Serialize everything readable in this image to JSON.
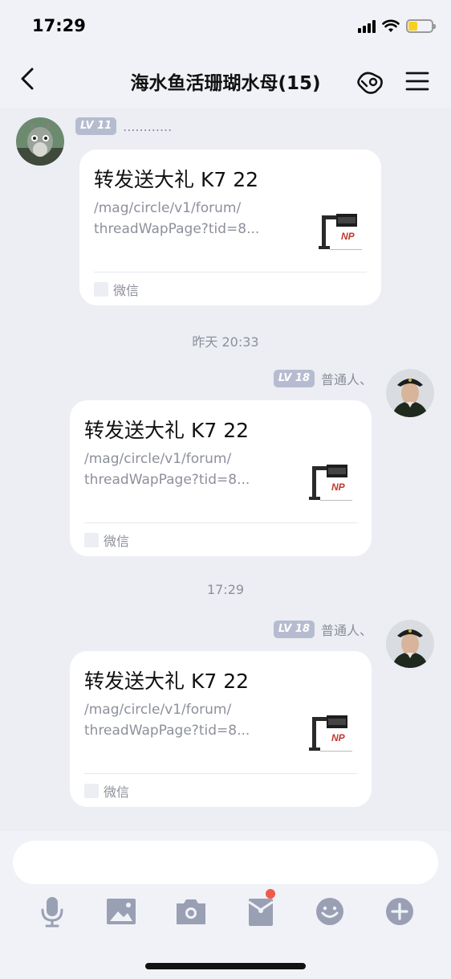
{
  "status_bar": {
    "time": "17:29"
  },
  "header": {
    "title": "海水鱼活珊瑚水母(15)"
  },
  "messages": [
    {
      "side": "left",
      "level": "LV 11",
      "sender": "............",
      "card": {
        "title": "转发送大礼 K7 22",
        "desc_line1": "/mag/circle/v1/forum/",
        "desc_line2": "threadWapPage?tid=8...",
        "source": "微信"
      }
    },
    {
      "timestamp": "昨天 20:33"
    },
    {
      "side": "right",
      "level": "LV 18",
      "sender": "普通人、",
      "card": {
        "title": "转发送大礼 K7 22",
        "desc_line1": "/mag/circle/v1/forum/",
        "desc_line2": "threadWapPage?tid=8...",
        "source": "微信"
      }
    },
    {
      "timestamp": "17:29"
    },
    {
      "side": "right",
      "level": "LV 18",
      "sender": "普通人、",
      "card": {
        "title": "转发送大礼 K7 22",
        "desc_line1": "/mag/circle/v1/forum/",
        "desc_line2": "threadWapPage?tid=8...",
        "source": "微信"
      }
    }
  ],
  "input": {
    "placeholder": ""
  },
  "toolbar": {
    "icons": [
      "microphone-icon",
      "image-icon",
      "camera-icon",
      "red-envelope-icon",
      "emoji-icon",
      "plus-icon"
    ]
  },
  "colors": {
    "background": "#eceef4",
    "bar": "#f1f2f7",
    "icon_gray": "#9aa0b4",
    "badge": "#b6bcd0",
    "notification": "#f05a4a"
  }
}
